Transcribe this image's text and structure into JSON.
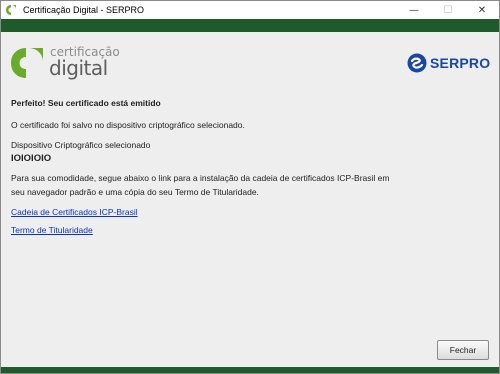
{
  "window": {
    "title": "Certificação Digital - SERPRO",
    "controls": {
      "minimize": "—",
      "maximize": "☐",
      "close": "✕"
    }
  },
  "header": {
    "product_logo": {
      "line1": "certificação",
      "line2": "digital",
      "icon": "leaf-logo-icon",
      "color_green": "#6aab2e",
      "color_text": "#5e5e5e"
    },
    "company_logo": {
      "text": "SERPRO",
      "icon": "serpro-swirl-icon",
      "color": "#1a47a6"
    }
  },
  "colors": {
    "green_band": "#1f5a2b",
    "background": "#eeeeee",
    "link": "#0b33c4"
  },
  "content": {
    "heading": "Perfeito! Seu certificado está emitido",
    "saved_message": "O certificado foi salvo no dispositivo criptográfico selecionado.",
    "device_label": "Dispositivo Criptográfico selecionado",
    "device_name": "IOIOIOIO",
    "info_line1": "Para sua comodidade, segue abaixo o link para a instalação da cadeia de certificados ICP-Brasil em",
    "info_line2": "seu navegador padrão e uma cópia do seu Termo de Titularidade.",
    "link_chain": "Cadeia de Certificados ICP-Brasil",
    "link_terms": "Termo de Titularidade"
  },
  "buttons": {
    "close_label": "Fechar"
  }
}
